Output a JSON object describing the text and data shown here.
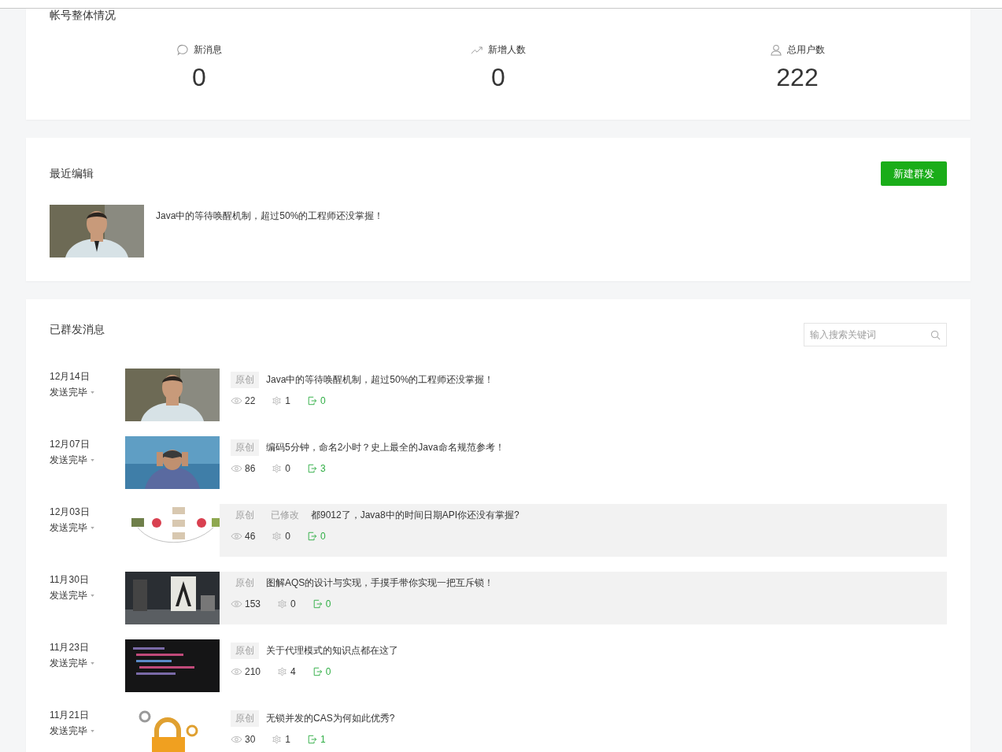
{
  "overview": {
    "title": "帐号整体情况",
    "stats": [
      {
        "kind": "message",
        "label": "新消息",
        "value": "0"
      },
      {
        "kind": "growth",
        "label": "新增人数",
        "value": "0"
      },
      {
        "kind": "users",
        "label": "总用户数",
        "value": "222"
      }
    ]
  },
  "recent": {
    "title": "最近编辑",
    "button": "新建群发",
    "item": {
      "title": "Java中的等待唤醒机制，超过50%的工程师还没掌握！"
    }
  },
  "sent": {
    "title": "已群发消息",
    "search": {
      "placeholder": "输入搜索关键词"
    },
    "rows": [
      {
        "date": "12月14日",
        "status": "发送完毕",
        "highlighted": false,
        "tags": [
          "原创"
        ],
        "title": "Java中的等待唤醒机制，超过50%的工程师还没掌握！",
        "views": "22",
        "likes": "1",
        "shares": "0"
      },
      {
        "date": "12月07日",
        "status": "发送完毕",
        "highlighted": false,
        "tags": [
          "原创"
        ],
        "title": "编码5分钟，命名2小时？史上最全的Java命名规范参考！",
        "views": "86",
        "likes": "0",
        "shares": "3"
      },
      {
        "date": "12月03日",
        "status": "发送完毕",
        "highlighted": true,
        "tags": [
          "原创",
          "已修改"
        ],
        "title": "都9012了，Java8中的时间日期API你还没有掌握?",
        "views": "46",
        "likes": "0",
        "shares": "0"
      },
      {
        "date": "11月30日",
        "status": "发送完毕",
        "highlighted": true,
        "tags": [
          "原创"
        ],
        "title": "图解AQS的设计与实现，手摸手带你实现一把互斥锁！",
        "views": "153",
        "likes": "0",
        "shares": "0"
      },
      {
        "date": "11月23日",
        "status": "发送完毕",
        "highlighted": false,
        "tags": [
          "原创"
        ],
        "title": "关于代理模式的知识点都在这了",
        "views": "210",
        "likes": "4",
        "shares": "0"
      },
      {
        "date": "11月21日",
        "status": "发送完毕",
        "highlighted": false,
        "tags": [
          "原创"
        ],
        "title": "无锁并发的CAS为何如此优秀?",
        "views": "30",
        "likes": "1",
        "shares": "1"
      }
    ]
  }
}
